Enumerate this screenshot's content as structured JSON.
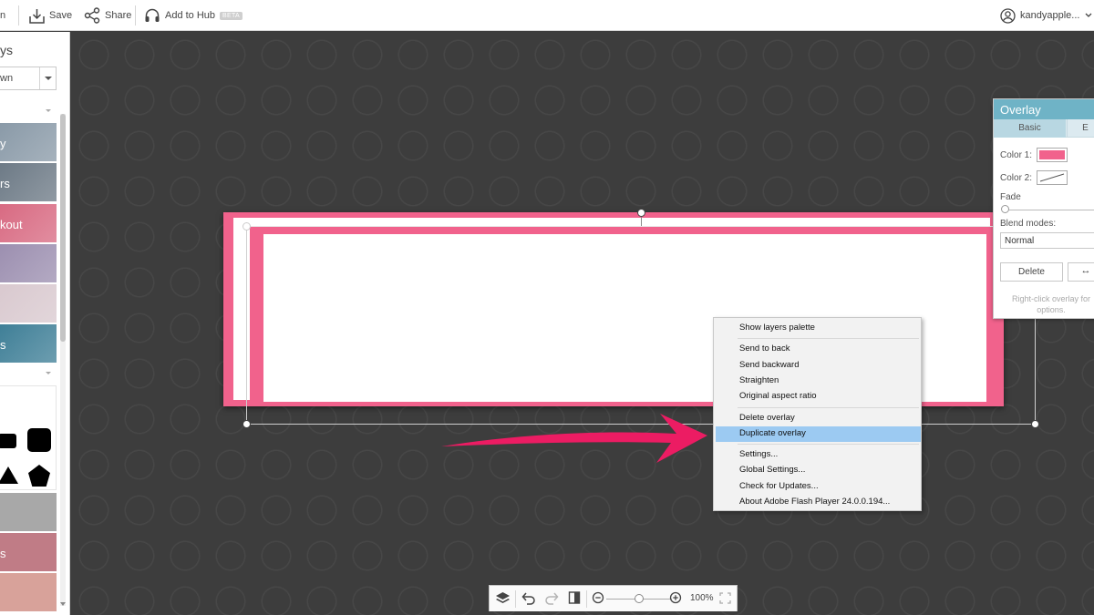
{
  "topbar": {
    "open_label_fragment": "n",
    "save_label": "Save",
    "share_label": "Share",
    "hub_label": "Add to Hub",
    "hub_badge": "BETA",
    "user_name": "kandyapple..."
  },
  "left_panel": {
    "title_fragment": "ys",
    "select_value": "wn",
    "thumbnails": [
      {
        "label": "y",
        "color": "#8a9aa8"
      },
      {
        "label": "rs",
        "color": "#6d7a86"
      },
      {
        "label": "kout",
        "color": "#d86a82"
      },
      {
        "label": "",
        "color": "#9c8fb0"
      },
      {
        "label": "",
        "color": "#d9c9cf"
      },
      {
        "label": "s",
        "color": "#3f7f97"
      }
    ],
    "thumbnails_lower": [
      {
        "label": "",
        "color": "#a8a8a8"
      },
      {
        "label": "s",
        "color": "#c07c86"
      },
      {
        "label": "",
        "color": "#d8a29a"
      }
    ]
  },
  "overlay_panel": {
    "title": "Overlay",
    "tabs": [
      "Basic",
      "E"
    ],
    "color1_label": "Color 1:",
    "color1_value": "#f1628c",
    "color2_label": "Color 2:",
    "fade_label": "Fade",
    "blend_label": "Blend modes:",
    "blend_value": "Normal",
    "delete_label": "Delete",
    "flip_label": "↔",
    "hint": "Right-click overlay for options."
  },
  "context_menu": {
    "groups": [
      [
        "Show layers palette"
      ],
      [
        "Send to back",
        "Send backward",
        "Straighten",
        "Original aspect ratio"
      ],
      [
        "Delete overlay",
        "Duplicate overlay"
      ],
      [
        "Settings...",
        "Global Settings...",
        "Check for Updates...",
        "About Adobe Flash Player 24.0.0.194..."
      ]
    ],
    "highlighted": "Duplicate overlay"
  },
  "bottom_toolbar": {
    "zoom_level": "100%"
  },
  "colors": {
    "design_pink": "#f1628c",
    "arrow_pink": "#ec1c63",
    "panel_header": "#6fb3c6",
    "menu_highlight": "#9ccaf2"
  }
}
